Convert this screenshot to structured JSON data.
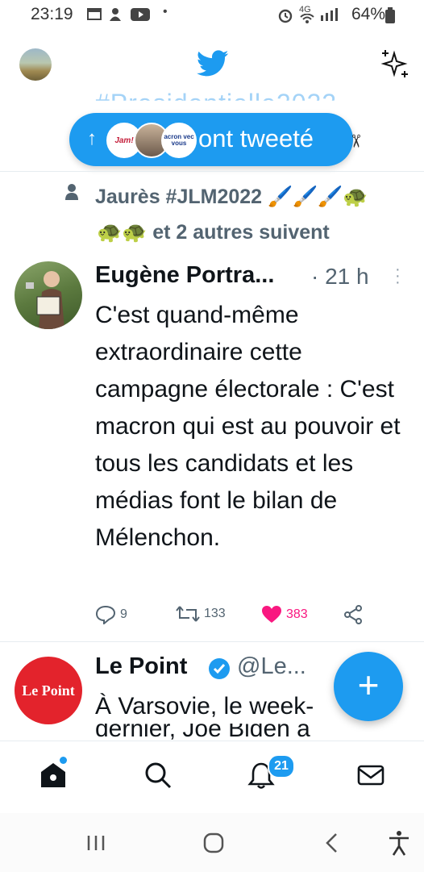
{
  "status_bar": {
    "time": "23:19",
    "network": "4G",
    "battery": "64%"
  },
  "header": {
    "hashtag_partial": "#Presidentielle2022"
  },
  "new_tweets_pill": {
    "label": "ont tweeté",
    "avatar_1_text": "Jam!",
    "avatar_3_text": "acron vec vous"
  },
  "social_context": {
    "line1": "Jaurès #JLM2022 🖌️🖌️🖌️🐢",
    "line2": "🐢🐢 et 2 autres suivent"
  },
  "tweet1": {
    "name": "Eugène Portra...",
    "time": "· 21 h",
    "text": "C'est quand-même extraordinaire cette campagne électorale : C'est macron qui est au pouvoir et tous les candidats et les médias font le bilan de Mélenchon.",
    "replies": "9",
    "retweets": "133",
    "likes": "383",
    "like_color": "#f91880"
  },
  "tweet2": {
    "name": "Le Point",
    "handle": "@Le...",
    "logo_text": "Le Point",
    "text_line": "À Varsovie, le week-",
    "text_cut": "dernier, Joe Biden a"
  },
  "tabbar": {
    "notifications_badge": "21"
  },
  "colors": {
    "accent": "#1d9bf0",
    "text": "#0f1419",
    "secondary": "#536471"
  }
}
